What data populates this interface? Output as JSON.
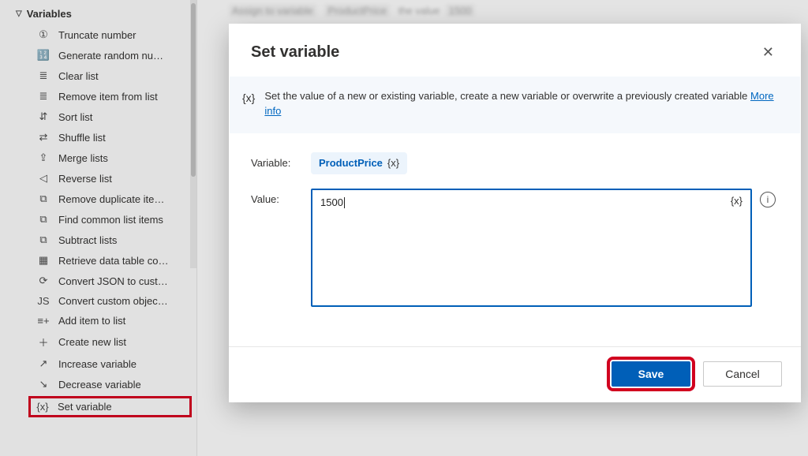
{
  "sidebar": {
    "group_label": "Variables",
    "items": [
      {
        "label": "Truncate number",
        "icon": "①"
      },
      {
        "label": "Generate random nu…",
        "icon": "🔢"
      },
      {
        "label": "Clear list",
        "icon": "≣"
      },
      {
        "label": "Remove item from list",
        "icon": "≣"
      },
      {
        "label": "Sort list",
        "icon": "⇵"
      },
      {
        "label": "Shuffle list",
        "icon": "⇄"
      },
      {
        "label": "Merge lists",
        "icon": "⇪"
      },
      {
        "label": "Reverse list",
        "icon": "◁"
      },
      {
        "label": "Remove duplicate ite…",
        "icon": "⧉"
      },
      {
        "label": "Find common list items",
        "icon": "⧉"
      },
      {
        "label": "Subtract lists",
        "icon": "⧉"
      },
      {
        "label": "Retrieve data table co…",
        "icon": "▦"
      },
      {
        "label": "Convert JSON to cust…",
        "icon": "⟳"
      },
      {
        "label": "Convert custom objec…",
        "icon": "JS"
      },
      {
        "label": "Add item to list",
        "icon": "≡+"
      },
      {
        "label": "Create new list",
        "icon": "＋"
      },
      {
        "label": "Increase variable",
        "icon": "↗"
      },
      {
        "label": "Decrease variable",
        "icon": "↘"
      },
      {
        "label": "Set variable",
        "icon": "{x}"
      }
    ]
  },
  "dialog": {
    "title": "Set variable",
    "info_prefix": "Set the value of a new or existing variable, create a new variable or overwrite a previously created variable ",
    "info_link": "More info",
    "field_variable_label": "Variable:",
    "variable_name": "ProductPrice",
    "variable_fx_label": "{x}",
    "field_value_label": "Value:",
    "value_text": "1500",
    "value_fx_label": "{x}",
    "save_label": "Save",
    "cancel_label": "Cancel"
  }
}
